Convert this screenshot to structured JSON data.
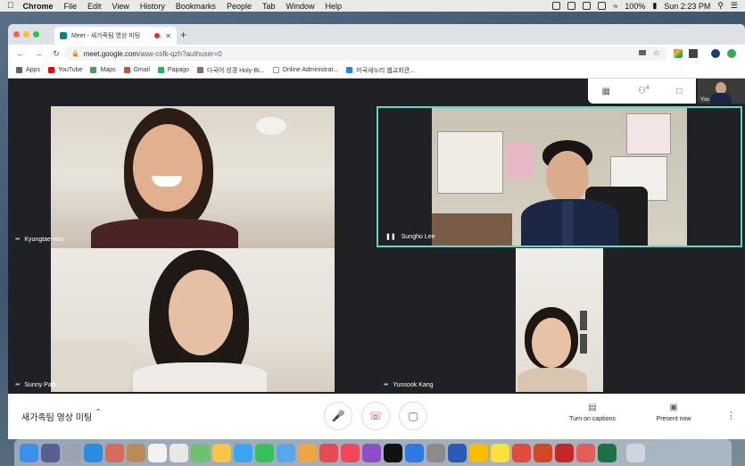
{
  "menubar": {
    "app": "Chrome",
    "items": [
      "File",
      "Edit",
      "View",
      "History",
      "Bookmarks",
      "People",
      "Tab",
      "Window",
      "Help"
    ],
    "battery": "100%",
    "clock": "Sun 2:23 PM"
  },
  "browser": {
    "tab_title": "Meet - 새가족팀 영상 미팅",
    "url_host": "meet.google.com",
    "url_path": "/asw-csfk-qzh?authuser=0",
    "bookmarks": [
      "Apps",
      "YouTube",
      "Maps",
      "Gmail",
      "Papago",
      "다국어 성경 Holy-Bi...",
      "Online Administrat...",
      "미국새누리 웹교회관..."
    ]
  },
  "meet": {
    "participant_count": "4",
    "self_label": "You",
    "participants": [
      {
        "name": "Kyungtae Han",
        "speaking": false
      },
      {
        "name": "Sungho Lee",
        "speaking": true
      },
      {
        "name": "Sunny Park",
        "speaking": false
      },
      {
        "name": "Yunsook Kang",
        "speaking": false
      }
    ],
    "meeting_title": "새가족팀 영상 미팅",
    "captions_label": "Turn on captions",
    "present_label": "Present now"
  },
  "colors": {
    "active_speaker_border": "#5fd8c4",
    "name_indicator": "#8ab4f8",
    "hangup": "#d93025"
  }
}
